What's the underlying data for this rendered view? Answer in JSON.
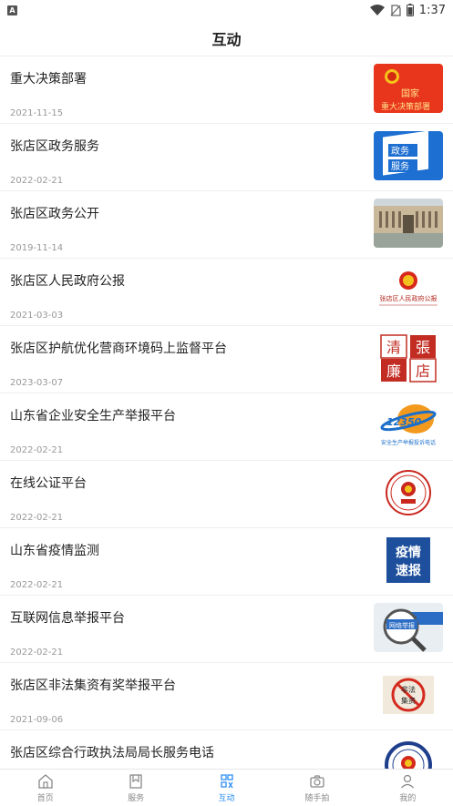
{
  "status_bar": {
    "notification_letter": "A",
    "time": "1:37"
  },
  "header": {
    "title": "互动"
  },
  "items": [
    {
      "title": "重大决策部署",
      "date": "2021-11-15",
      "thumb_icon": "decision-banner-image",
      "thumb_text": [
        "国家",
        "重大决策部署"
      ]
    },
    {
      "title": "张店区政务服务",
      "date": "2022-02-21",
      "thumb_icon": "gov-service-image",
      "thumb_text": [
        "政务",
        "服务"
      ]
    },
    {
      "title": "张店区政务公开",
      "date": "2019-11-14",
      "thumb_icon": "gov-building-image",
      "thumb_text": []
    },
    {
      "title": "张店区人民政府公报",
      "date": "2021-03-03",
      "thumb_icon": "gazette-emblem-image",
      "thumb_text": [
        "张店区人民政府公报"
      ]
    },
    {
      "title": "张店区护航优化营商环境码上监督平台",
      "date": "2023-03-07",
      "thumb_icon": "clean-seal-image",
      "thumb_text": [
        "清",
        "張",
        "廉",
        "店"
      ]
    },
    {
      "title": "山东省企业安全生产举报平台",
      "date": "2022-02-21",
      "thumb_icon": "hotline-12350-image",
      "thumb_text": [
        "12350",
        "安全生产举报投诉电话"
      ]
    },
    {
      "title": "在线公证平台",
      "date": "2022-02-21",
      "thumb_icon": "notary-seal-image",
      "thumb_text": []
    },
    {
      "title": "山东省疫情监测",
      "date": "2022-02-21",
      "thumb_icon": "epidemic-news-image",
      "thumb_text": [
        "疫情",
        "速报"
      ]
    },
    {
      "title": "互联网信息举报平台",
      "date": "2022-02-21",
      "thumb_icon": "magnifier-report-image",
      "thumb_text": [
        "网络举报"
      ]
    },
    {
      "title": "张店区非法集资有奖举报平台",
      "date": "2021-09-06",
      "thumb_icon": "illegal-fund-image",
      "thumb_text": [
        "非法",
        "集资"
      ]
    },
    {
      "title": "张店区综合行政执法局局长服务电话",
      "date": "",
      "thumb_icon": "enforcement-badge-image",
      "thumb_text": []
    }
  ],
  "tabs": [
    {
      "label": "首页",
      "icon": "home-icon",
      "active": false
    },
    {
      "label": "服务",
      "icon": "bookmark-icon",
      "active": false
    },
    {
      "label": "互动",
      "icon": "interact-icon",
      "active": true
    },
    {
      "label": "随手拍",
      "icon": "camera-icon",
      "active": false
    },
    {
      "label": "我的",
      "icon": "user-icon",
      "active": false
    }
  ],
  "colors": {
    "accent": "#2a8cf0",
    "inactive_tab": "#888888",
    "date_text": "#999999"
  }
}
